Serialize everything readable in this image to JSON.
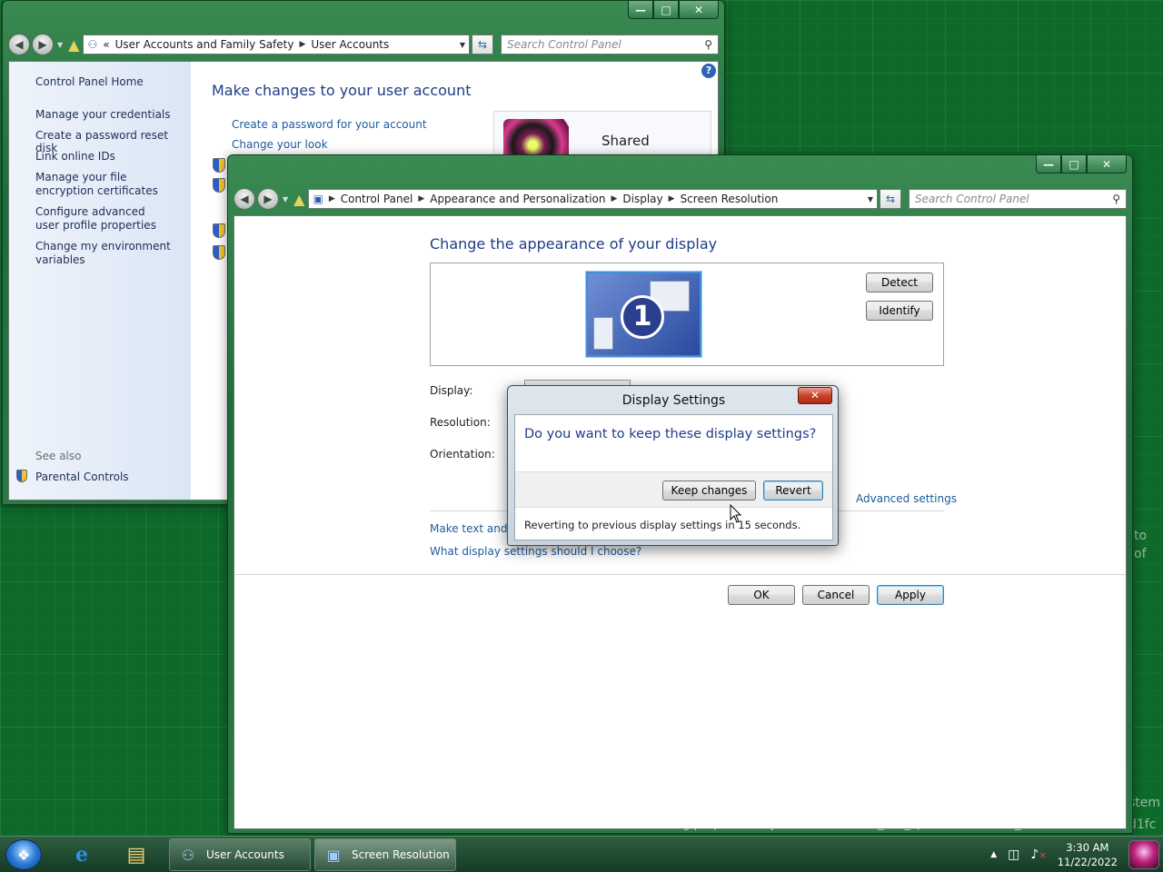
{
  "desktop": {
    "watermark_fragments": [
      "to",
      "of",
      "stem",
      "d1fc"
    ],
    "build_text": "For testing purposes only. Build 7048.win7_rtm_sp1.090601-1800_d1fc"
  },
  "user_accounts_window": {
    "address": {
      "chevron": "«",
      "crumbs": [
        "User Accounts and Family Safety",
        "User Accounts"
      ]
    },
    "search_placeholder": "Search Control Panel",
    "sidebar": {
      "home": "Control Panel Home",
      "links": [
        "Manage your credentials",
        "Create a password reset disk",
        "Link online IDs",
        "Manage your file encryption certificates",
        "Configure advanced user profile properties",
        "Change my environment variables"
      ],
      "see_also": "See also",
      "parental_controls": "Parental Controls"
    },
    "main": {
      "title": "Make changes to your user account",
      "links": [
        "Create a password for your account",
        "Change your look"
      ],
      "account_name": "Shared"
    },
    "help_label": "?"
  },
  "screen_resolution_window": {
    "address": {
      "crumbs": [
        "Control Panel",
        "Appearance and Personalization",
        "Display",
        "Screen Resolution"
      ]
    },
    "search_placeholder": "Search Control Panel",
    "title": "Change the appearance of your display",
    "monitor_number": "1",
    "buttons": {
      "detect": "Detect",
      "identify": "Identify",
      "ok": "OK",
      "cancel": "Cancel",
      "apply": "Apply"
    },
    "fields": {
      "display": "Display:",
      "resolution": "Resolution:",
      "orientation": "Orientation:"
    },
    "advanced_settings": "Advanced settings",
    "links": [
      "Make text and other items larger or smaller",
      "What display settings should I choose?"
    ]
  },
  "dialog": {
    "title": "Display Settings",
    "question": "Do you want to keep these display settings?",
    "keep": "Keep changes",
    "revert": "Revert",
    "countdown": "Reverting to previous display settings in 15 seconds."
  },
  "taskbar": {
    "tasks": [
      "User Accounts",
      "Screen Resolution"
    ],
    "time": "3:30 AM",
    "date": "11/22/2022",
    "tray_arrow": "▲"
  },
  "icons": {
    "start": "windows-orb-icon",
    "ie": "internet-explorer-icon",
    "explorer": "folder-icon",
    "network": "network-icon",
    "volume": "volume-muted-icon"
  }
}
